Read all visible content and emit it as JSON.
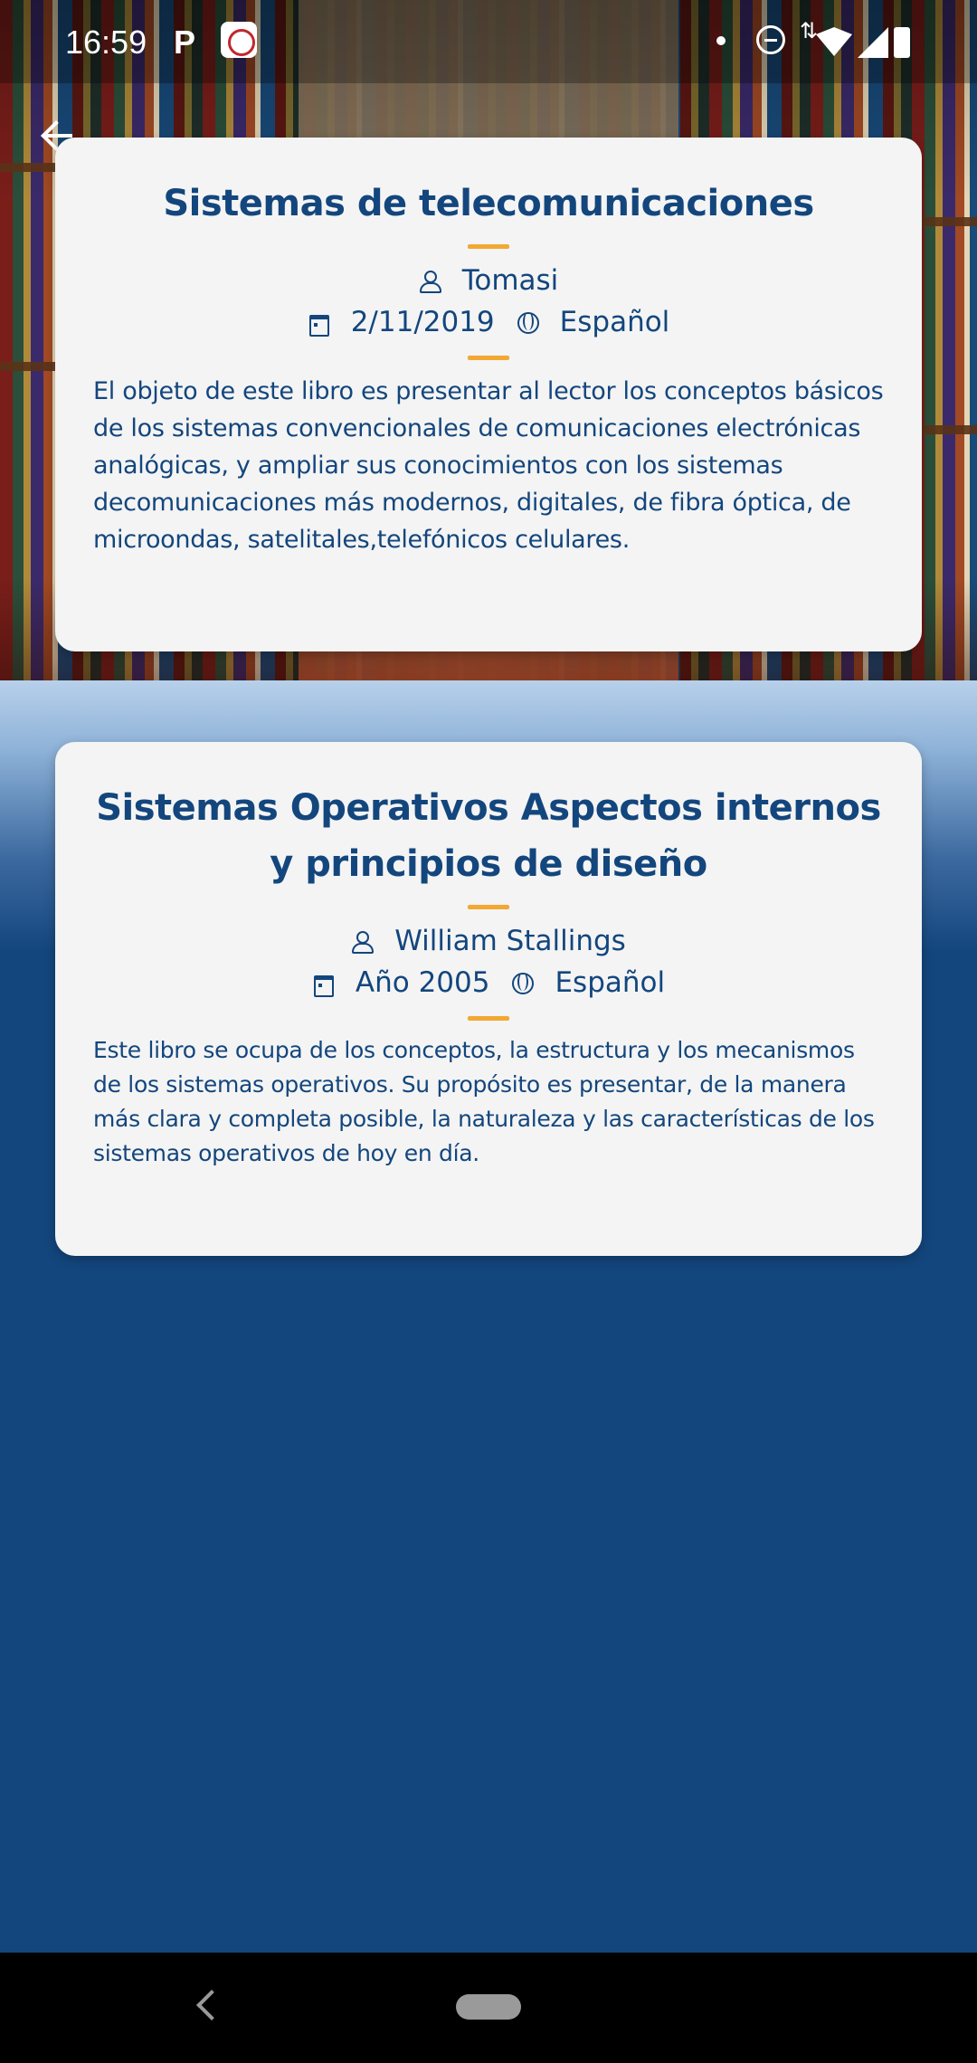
{
  "status_bar": {
    "time": "16:59",
    "icons": [
      "parking-app-icon",
      "notification-app-icon",
      "dot-icon",
      "do-not-disturb-icon",
      "data-arrows-icon",
      "wifi-icon",
      "signal-icon",
      "battery-icon"
    ]
  },
  "header": {
    "back_icon": "back-arrow-icon"
  },
  "books": [
    {
      "title": "Sistemas de telecomunicaciones",
      "author": "Tomasi",
      "date": "2/11/2019",
      "language": "Español",
      "description": "El objeto de este libro es presentar al lector los conceptos básicos de los sistemas convencionales de comunicaciones electrónicas analógicas, y ampliar sus conocimientos con los sistemas decomunicaciones más modernos, digitales, de fibra óptica, de microondas, satelitales,telefónicos celulares."
    },
    {
      "title": "Sistemas Operativos Aspectos internos y principios de diseño",
      "author": "William Stallings",
      "date": "Año 2005",
      "language": "Español",
      "description": "Este libro se ocupa de los conceptos, la estructura y los mecanismos de los sistemas operativos. Su propósito es presentar, de la manera más clara y completa posible, la naturaleza y las características de los sistemas operativos de hoy en día."
    }
  ],
  "nav_bar": {
    "icons": [
      "nav-back-icon",
      "nav-home-pill-icon"
    ]
  },
  "colors": {
    "primary": "#13467d",
    "accent": "#f2a832",
    "card": "#f4f4f4",
    "nav_bar": "#000000"
  }
}
